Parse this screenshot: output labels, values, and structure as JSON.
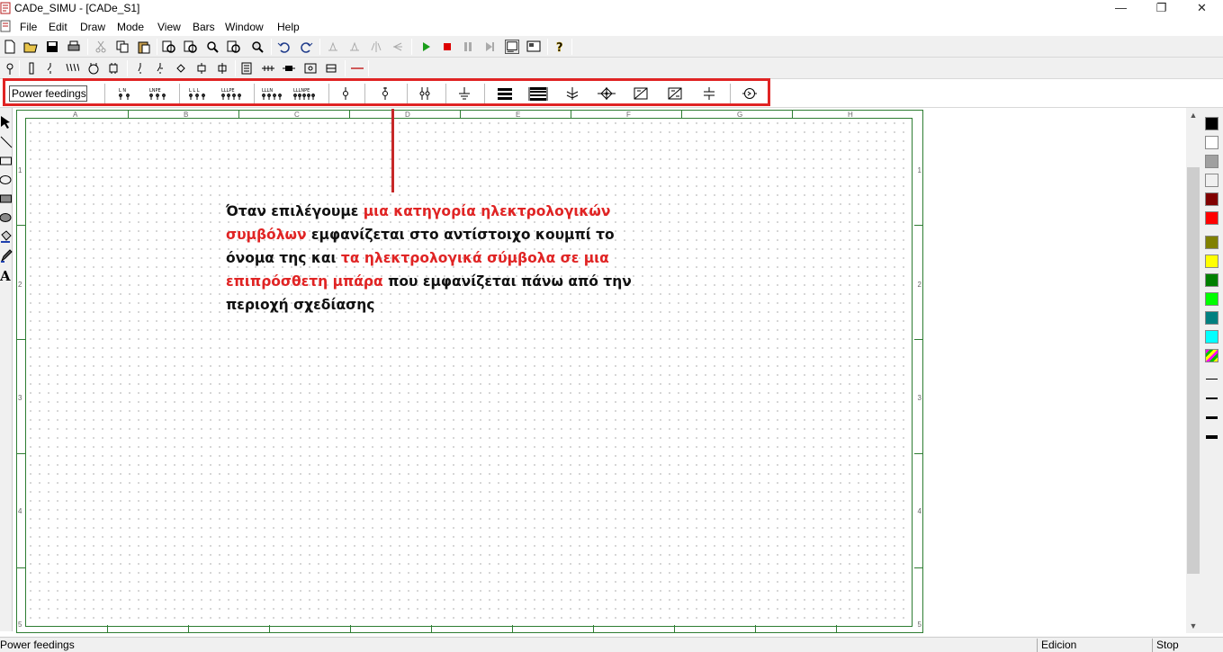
{
  "window": {
    "title": "CADe_SIMU - [CADe_S1]",
    "controls": {
      "minimize": "—",
      "maximize": "❐",
      "close": "✕"
    }
  },
  "menubar": {
    "items": [
      "File",
      "Edit",
      "Draw",
      "Mode",
      "View",
      "Bars",
      "Window",
      "Help"
    ]
  },
  "symbol_bar": {
    "category_button": "Power feedings",
    "symbols": [
      "L N",
      "L N PE",
      "L L L",
      "L L L PE",
      "L L L N",
      "L L L N PE",
      "single-phase-source",
      "dc-source",
      "double-source",
      "ground",
      "busbar-3",
      "busbar-4",
      "earth-terminal",
      "star-point",
      "transformer-1",
      "transformer-2",
      "capacitor",
      "generator"
    ]
  },
  "sheet": {
    "columns": [
      "A",
      "B",
      "C",
      "D",
      "E",
      "F",
      "G",
      "H"
    ],
    "rows": [
      "1",
      "2",
      "3",
      "4",
      "5"
    ]
  },
  "annotation": {
    "p1": "Όταν επιλέγουμε ",
    "p2": "μια κατηγορία ηλεκτρολογικών συμβόλων",
    "p3": " εμφανίζεται στο αντίστοιχο κουμπί το όνομα της και ",
    "p4": "τα ηλεκτρολογικά σύμβολα σε μια επιπρόσθετη μπάρα",
    "p5": " που εμφανίζεται πάνω από την περιοχή σχεδίασης"
  },
  "palette": {
    "colors": [
      "#000000",
      "#ffffff",
      "#a0a0a0",
      "#f0f0f0",
      "#800000",
      "#ff0000",
      "#808000",
      "#ffff00",
      "#008000",
      "#00ff00",
      "#008080",
      "#00ffff"
    ]
  },
  "statusbar": {
    "hint": "Power feedings",
    "mode": "Edicion",
    "sim": "Stop"
  },
  "colors": {
    "highlight": "#e02424",
    "sheet_border": "#2e7d32"
  }
}
